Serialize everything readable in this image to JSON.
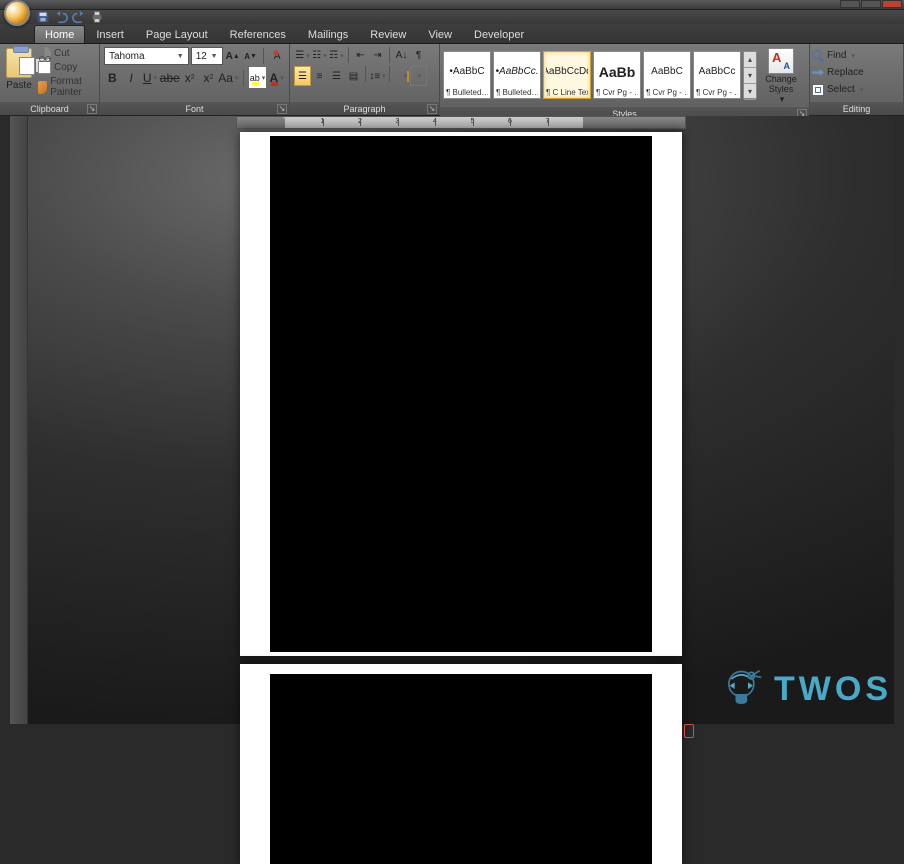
{
  "tabs": [
    "Home",
    "Insert",
    "Page Layout",
    "References",
    "Mailings",
    "Review",
    "View",
    "Developer"
  ],
  "active_tab": "Home",
  "clipboard": {
    "paste": "Paste",
    "cut": "Cut",
    "copy": "Copy",
    "format_painter": "Format Painter",
    "label": "Clipboard"
  },
  "font": {
    "name": "Tahoma",
    "size": "12",
    "label": "Font",
    "grow": "A",
    "shrink": "A",
    "clear": "Aa",
    "bold": "B",
    "italic": "I",
    "underline": "U",
    "strike": "abe",
    "sub": "x",
    "sup": "x",
    "case": "Aa",
    "hl": "ab",
    "color": "A"
  },
  "paragraph": {
    "label": "Paragraph"
  },
  "styles": {
    "label": "Styles",
    "items": [
      {
        "preview": "AaBbC",
        "name": "¶ Bulleted…",
        "bullet": true
      },
      {
        "preview": "AaBbCc.",
        "name": "¶ Bulleted…",
        "bullet": true,
        "ital": true
      },
      {
        "preview": "AaBbCcDd",
        "name": "¶ C Line Text",
        "sel": true
      },
      {
        "preview": "AaBb",
        "name": "¶ Cvr Pg - …",
        "big": true
      },
      {
        "preview": "AaBbC",
        "name": "¶ Cvr Pg - …"
      },
      {
        "preview": "AaBbCc",
        "name": "¶ Cvr Pg - …"
      }
    ],
    "change": "Change Styles"
  },
  "editing": {
    "find": "Find",
    "replace": "Replace",
    "select": "Select",
    "label": "Editing"
  },
  "ruler_numbers": [
    "1",
    "2",
    "3",
    "4",
    "5",
    "6",
    "7"
  ],
  "watermark": "TWOS"
}
